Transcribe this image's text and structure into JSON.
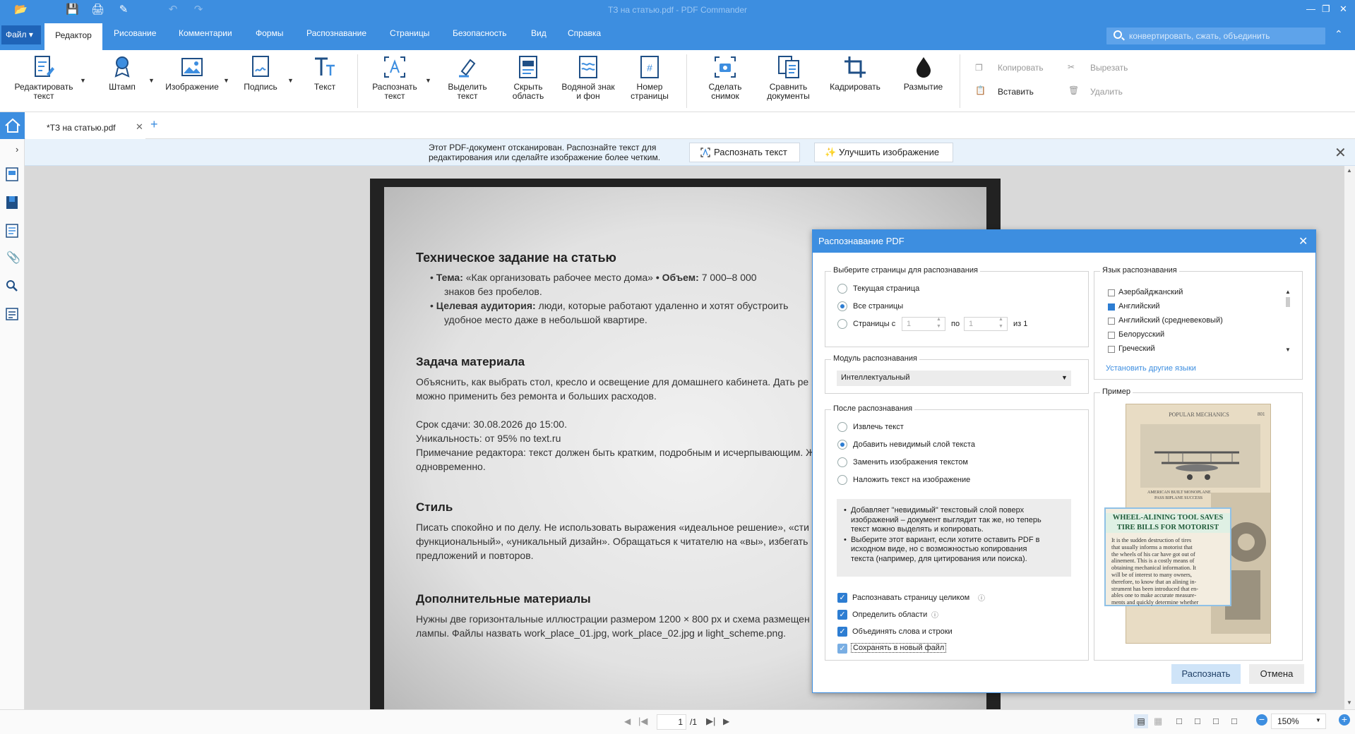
{
  "titlebar": {
    "title": "ТЗ на статью.pdf - PDF Commander"
  },
  "menubar": {
    "file": "Файл",
    "tabs": [
      "Редактор",
      "Рисование",
      "Комментарии",
      "Формы",
      "Распознавание",
      "Страницы",
      "Безопасность",
      "Вид",
      "Справка"
    ],
    "search_placeholder": "конвертировать, сжать, объединить"
  },
  "ribbon": {
    "edit_text": [
      "Редактировать",
      "текст"
    ],
    "stamp": "Штамп",
    "image": "Изображение",
    "signature": "Подпись",
    "text": "Текст",
    "recognize_text": [
      "Распознать",
      "текст"
    ],
    "select_text": [
      "Выделить",
      "текст"
    ],
    "hide_area": [
      "Скрыть",
      "область"
    ],
    "watermark": [
      "Водяной знак",
      "и фон"
    ],
    "page_number": [
      "Номер",
      "страницы"
    ],
    "snapshot": [
      "Сделать",
      "снимок"
    ],
    "compare": [
      "Сравнить",
      "документы"
    ],
    "crop": "Кадрировать",
    "blur": "Размытие",
    "copy": "Копировать",
    "paste": "Вставить",
    "cut": "Вырезать",
    "delete": "Удалить"
  },
  "doc_tab": {
    "name": "*ТЗ на статью.pdf"
  },
  "notify": {
    "line1": "Этот PDF-документ отсканирован. Распознайте текст для",
    "line2": "редактирования или сделайте изображение более четким.",
    "recognize_btn": "Распознать текст",
    "enhance_btn": "Улучшить изображение"
  },
  "document": {
    "h1": "Техническое задание на статью",
    "b1_label": "Тема:",
    "b1_text": " «Как организовать рабочее место дома» ",
    "b1_label2": "• Объем:",
    "b1_text2": " 7 000–8 000",
    "b1_line2": "знаков без пробелов.",
    "b2_label": "Целевая аудитория:",
    "b2_text": " люди, которые работают удаленно и хотят обустроить",
    "b2_line2": "удобное место даже в небольшой квартире.",
    "h2": "Задача материала",
    "p1": "Объяснить, как выбрать стол, кресло и освещение для домашнего кабинета. Дать ре",
    "p2": "можно применить без ремонта и больших расходов.",
    "p3": "Срок сдачи: 30.08.2026 до 15:00.",
    "p4": "Уникальность: от 95% по text.ru",
    "p5": "Примечание редактора: текст должен быть кратким, подробным и исчерпывающим. Ж",
    "p6": "одновременно.",
    "h3": "Стиль",
    "p7": "Писать спокойно и по делу. Не использовать выражения «идеальное решение», «сти",
    "p8": "функциональный», «уникальный дизайн». Обращаться к читателю на «вы», избегать",
    "p9": "предложений и повторов.",
    "h4": "Дополнительные материалы",
    "p10": "Нужны две горизонтальные иллюстрации размером 1200 × 800 px и схема размещен",
    "p11": "лампы. Файлы назвать work_place_01.jpg, work_place_02.jpg и light_scheme.png."
  },
  "dialog": {
    "title": "Распознавание PDF",
    "pages_group": "Выберите страницы для распознавания",
    "current_page": "Текущая страница",
    "all_pages": "Все страницы",
    "pages_from": "Страницы с",
    "from_val": "1",
    "to_label": "по",
    "to_val": "1",
    "of_label": "из 1",
    "module_group": "Модуль распознавания",
    "module_value": "Интеллектуальный",
    "after_group": "После распознавания",
    "opt_extract": "Извлечь текст",
    "opt_invisible": "Добавить невидимый слой текста",
    "opt_replace": "Заменить изображения текстом",
    "opt_overlay": "Наложить текст на изображение",
    "info1_l1": "Добавляет \"невидимый\" текстовый слой поверх",
    "info1_l2": "изображений – документ выглядит так же, но теперь",
    "info1_l3": "текст можно выделять и копировать.",
    "info2_l1": "Выберите этот вариант, если хотите оставить PDF в",
    "info2_l2": "исходном виде, но с возможностью копирования",
    "info2_l3": "текста (например, для цитирования или поиска).",
    "chk_whole_page": "Распознавать страницу целиком",
    "chk_detect_areas": "Определить области",
    "chk_merge": "Объединять слова и строки",
    "chk_save_new": "Сохранять в новый файл",
    "lang_group": "Язык распознавания",
    "languages": [
      {
        "name": "Азербайджанский",
        "checked": false
      },
      {
        "name": "Английский",
        "checked": true
      },
      {
        "name": "Английский (средневековый)",
        "checked": false
      },
      {
        "name": "Белорусский",
        "checked": false
      },
      {
        "name": "Греческий",
        "checked": false
      }
    ],
    "install_langs": "Установить другие языки",
    "preview_group": "Пример",
    "preview": {
      "masthead": "POPULAR MECHANICS",
      "page_no": "801",
      "caption1": "AMERICAN BUILT MONOPLANE",
      "caption2": "PASS BIPLANE SUCCESS",
      "headline1": "WHEEL-ALINING TOOL SAVES",
      "headline2": "TIRE BILLS FOR MOTORIST",
      "body": [
        "It is the sudden destruction of tires",
        "that usually informs a motorist that",
        "the wheels of his car have got out of",
        "alinement. This is a costly means of",
        "obtaining mechanical information. It",
        "will be of interest to many owners,",
        "therefore, to know that an alining in-",
        "strument has been introduced that en-",
        "ables one to make accurate measure-",
        "ments and quickly determine whether"
      ]
    },
    "btn_recognize": "Распознать",
    "btn_cancel": "Отмена"
  },
  "statusbar": {
    "page_current": "1",
    "page_total": "/1",
    "zoom": "150%"
  },
  "colors": {
    "accent": "#3d8ee0",
    "file_btn": "#1f64b8"
  }
}
